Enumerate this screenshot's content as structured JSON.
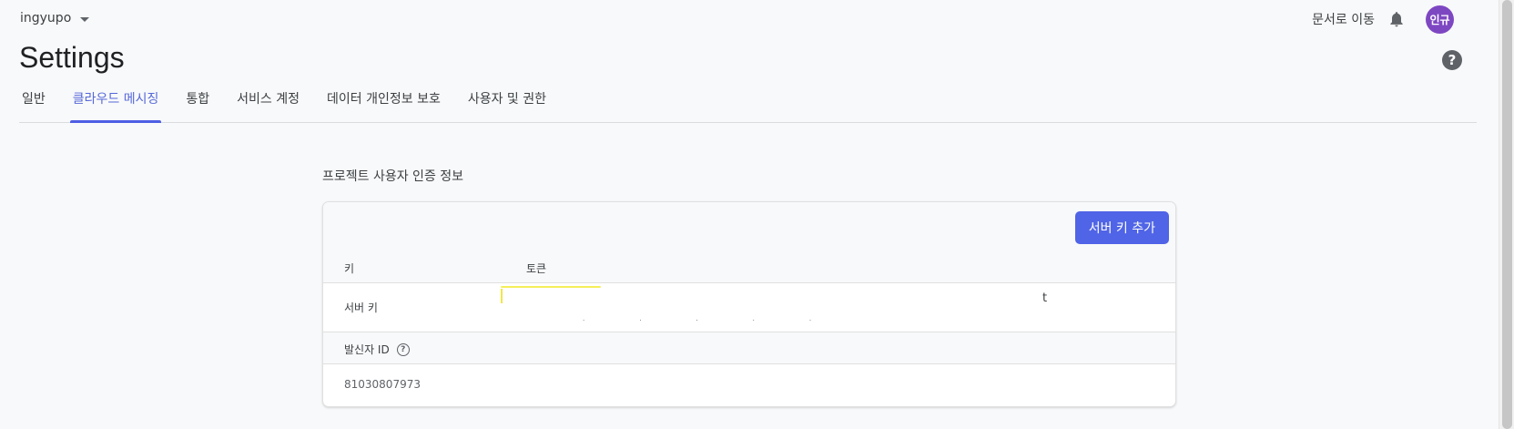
{
  "header": {
    "project_name": "ingyupo",
    "docs_link": "문서로 이동",
    "avatar_initials": "인규",
    "page_title": "Settings",
    "help_symbol": "?"
  },
  "tabs": [
    {
      "label": "일반",
      "active": false
    },
    {
      "label": "클라우드 메시징",
      "active": true
    },
    {
      "label": "통합",
      "active": false
    },
    {
      "label": "서비스 계정",
      "active": false
    },
    {
      "label": "데이터 개인정보 보호",
      "active": false
    },
    {
      "label": "사용자 및 권한",
      "active": false
    }
  ],
  "credentials": {
    "section_title": "프로젝트 사용자 인증 정보",
    "add_button": "서버 키 추가",
    "col_key": "키",
    "col_token": "토큰",
    "server_key_label": "서버 키",
    "token_visible_char": "t",
    "sender_id_label": "발신자 ID",
    "sender_id_value": "81030807973"
  },
  "colors": {
    "accent": "#4f64e6",
    "active_tab_text": "#5668d9",
    "avatar_bg": "#7e47c2",
    "highlight": "#f5ef5a"
  },
  "icons": {
    "bell": "bell-icon",
    "help": "help-circle-icon",
    "caret": "caret-down-icon",
    "info": "question-circle-icon"
  }
}
